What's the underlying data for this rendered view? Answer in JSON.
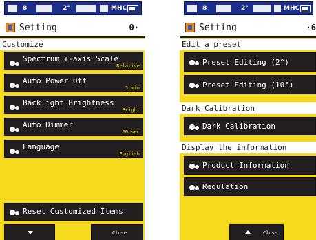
{
  "colors": {
    "screen_bg": "#f5da1e",
    "button_bg": "#231f20",
    "status_bar": "#1e2f8a",
    "value_text": "#f5da1e"
  },
  "left_screen": {
    "status": {
      "t1": "8",
      "t2": "2°",
      "t3": "MHC"
    },
    "header": {
      "title": "Setting",
      "right": "0·",
      "icon": "setting-icon"
    },
    "section": "Customize",
    "items": [
      {
        "label": "Spectrum Y-axis Scale",
        "value": "Relative",
        "icon": "gear-icon"
      },
      {
        "label": "Auto Power Off",
        "value": "5 min",
        "icon": "gear-icon"
      },
      {
        "label": "Backlight Brightness",
        "value": "Bright",
        "icon": "gear-icon"
      },
      {
        "label": "Auto Dimmer",
        "value": "60 sec",
        "icon": "gear-icon"
      },
      {
        "label": "Language",
        "value": "English",
        "icon": "gear-icon"
      }
    ],
    "reset_label": "Reset Customized Items",
    "footer": {
      "down_icon": "arrow-down-icon",
      "close_label": "Close"
    }
  },
  "right_screen": {
    "status": {
      "t1": "8",
      "t2": "2°",
      "t3": "MHC"
    },
    "header": {
      "title": "Setting",
      "right": "·6",
      "icon": "setting-icon"
    },
    "sections": {
      "preset": "Edit a preset",
      "dark": "Dark Calibration",
      "display": "Display the information"
    },
    "items": {
      "preset_2": "Preset Editing (2°)",
      "preset_10": "Preset Editing (10°)",
      "dark_cal": "Dark Calibration",
      "product_info": "Product Information",
      "regulation": "Regulation"
    },
    "footer": {
      "up_icon": "arrow-up-icon",
      "close_label": "Close"
    }
  }
}
